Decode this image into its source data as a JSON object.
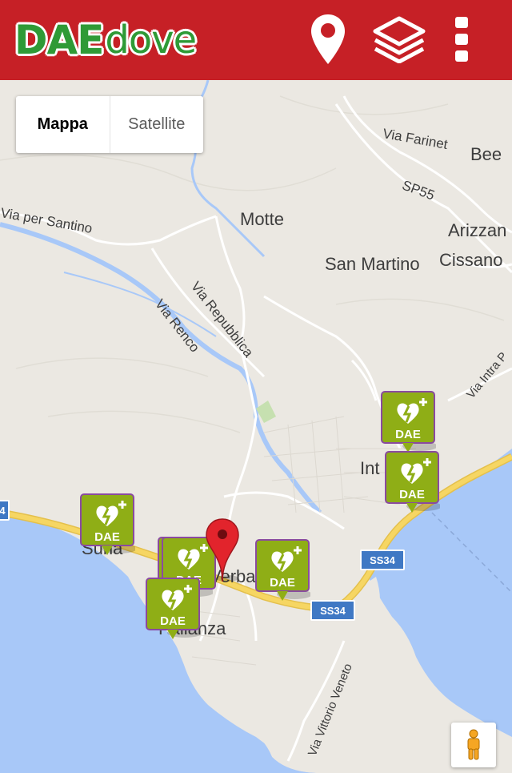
{
  "app": {
    "logo_dae": "DAE",
    "logo_dove": "dove"
  },
  "toolbar": {
    "location_icon": "location-pin-icon",
    "layers_icon": "layers-icon",
    "menu_icon": "overflow-menu-icon"
  },
  "map_type": {
    "map_label": "Mappa",
    "satellite_label": "Satellite"
  },
  "map_labels": {
    "via_farinet": "Via Farinet",
    "bee": "Bee",
    "sp55": "SP55",
    "motte": "Motte",
    "arizzano": "Arizzan",
    "via_per_santino": "Via per Santino",
    "san_martino": "San Martino",
    "cissano": "Cissano",
    "via_renco": "Via Renco",
    "via_repubblica": "Via Repubblica",
    "via_intra": "Via Intra P",
    "intra": "Int",
    "suna": "Suna",
    "verbania": "Verbania",
    "pallanza": "Pallanza",
    "via_vittorio_veneto": "Via Vittorio Veneto",
    "ss34_a": "SS34",
    "ss34_b": "SS34",
    "route_left": "4"
  },
  "markers": {
    "label": "DAE",
    "icon": "aed-heart-icon"
  },
  "colors": {
    "topbar": "#c62026",
    "logo_green": "#2f9a36",
    "marker_green": "#8fae16",
    "marker_border": "#8a4aa0",
    "water": "#a8c8f8",
    "land": "#ebe8e2",
    "road_yellow": "#f6d663",
    "pin_red": "#e2242c"
  },
  "streetview": {
    "icon": "pegman-icon"
  }
}
